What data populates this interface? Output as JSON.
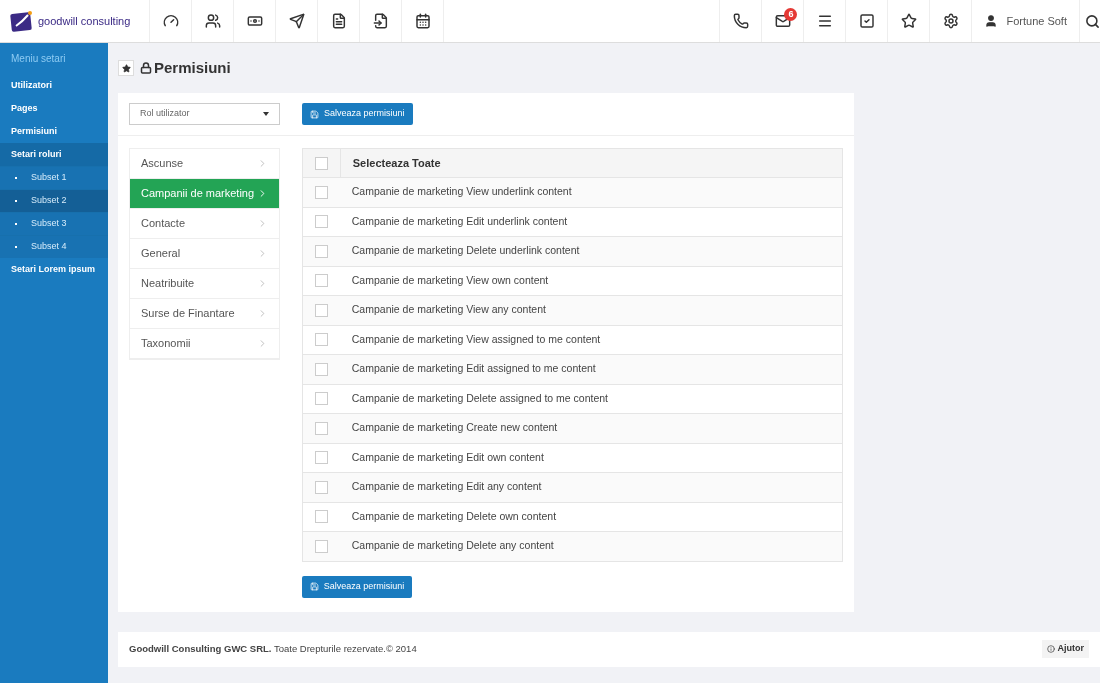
{
  "brand": {
    "name": "goodwill consulting"
  },
  "toolbar_left": [
    {
      "kind": "dashboard"
    },
    {
      "kind": "users"
    },
    {
      "kind": "money"
    },
    {
      "kind": "send"
    },
    {
      "kind": "document"
    },
    {
      "kind": "file-pin"
    },
    {
      "kind": "calendar"
    }
  ],
  "toolbar_right": [
    {
      "kind": "phone"
    },
    {
      "kind": "mail",
      "badge": "6"
    },
    {
      "kind": "menu"
    },
    {
      "kind": "check"
    },
    {
      "kind": "star"
    },
    {
      "kind": "settings"
    }
  ],
  "user": {
    "name": "Fortune Soft"
  },
  "sidebar": {
    "title": "Meniu setari",
    "items": [
      {
        "label": "Utilizatori",
        "selected": false
      },
      {
        "label": "Pages",
        "selected": false
      },
      {
        "label": "Permisiuni",
        "selected": false
      },
      {
        "label": "Setari roluri",
        "selected": true,
        "children": [
          {
            "label": "Subset 1",
            "selected": false
          },
          {
            "label": "Subset 2",
            "selected": true
          },
          {
            "label": "Subset 3",
            "selected": false
          },
          {
            "label": "Subset 4",
            "selected": false
          }
        ]
      },
      {
        "label": "Setari Lorem ipsum",
        "selected": false
      }
    ]
  },
  "page": {
    "title": "Permisiuni"
  },
  "role_select": {
    "placeholder": "Rol utilizator"
  },
  "save_button": "Salveaza permisiuni",
  "categories": [
    {
      "label": "Ascunse",
      "selected": false
    },
    {
      "label": "Campanii de marketing",
      "selected": true
    },
    {
      "label": "Contacte",
      "selected": false
    },
    {
      "label": "General",
      "selected": false
    },
    {
      "label": "Neatribuite",
      "selected": false
    },
    {
      "label": "Surse de Finantare",
      "selected": false
    },
    {
      "label": "Taxonomii",
      "selected": false
    }
  ],
  "permissions": {
    "select_all": {
      "label": "Selecteaza Toate",
      "checked": false
    },
    "rows": [
      {
        "label": "Campanie de marketing View underlink content",
        "checked": false
      },
      {
        "label": "Campanie de marketing Edit underlink content",
        "checked": false
      },
      {
        "label": "Campanie de marketing Delete underlink content",
        "checked": false
      },
      {
        "label": "Campanie de marketing View own content",
        "checked": false
      },
      {
        "label": "Campanie de marketing View any content",
        "checked": false
      },
      {
        "label": "Campanie de marketing View assigned to me content",
        "checked": false
      },
      {
        "label": "Campanie de marketing Edit assigned to me content",
        "checked": false
      },
      {
        "label": "Campanie de marketing Delete assigned to me content",
        "checked": false
      },
      {
        "label": "Campanie de marketing Create new content",
        "checked": false
      },
      {
        "label": "Campanie de marketing Edit own content",
        "checked": false
      },
      {
        "label": "Campanie de marketing Edit any content",
        "checked": false
      },
      {
        "label": "Campanie de marketing Delete own content",
        "checked": false
      },
      {
        "label": "Campanie de marketing Delete any content",
        "checked": false
      }
    ]
  },
  "save_button_bottom": "Salveaza permisiuni",
  "footer": {
    "text": "**Goodwill Consulting GWC SRL.** Toate Drepturile rezervate.© 2014",
    "help": "Ajutor"
  }
}
